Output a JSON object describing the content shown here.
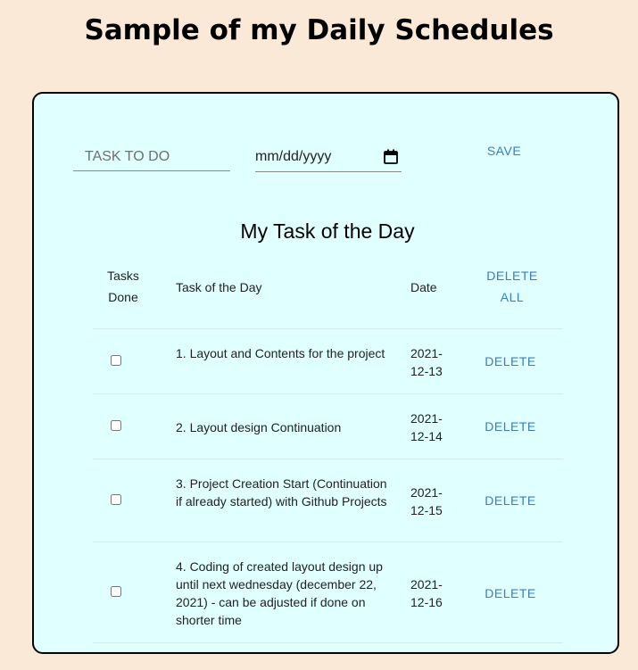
{
  "page": {
    "title": "Sample of my Daily Schedules"
  },
  "form": {
    "task_placeholder": "TASK TO DO",
    "date_placeholder": "mm/dd/yyyy",
    "save_label": "SAVE"
  },
  "list": {
    "title": "My Task of the Day",
    "headers": {
      "done_line1": "Tasks",
      "done_line2": "Done",
      "task": "Task of the Day",
      "date": "Date",
      "delete_all_line1": "DELETE",
      "delete_all_line2": "ALL"
    },
    "rows": [
      {
        "done": false,
        "task": "1. Layout and Contents for the project",
        "date": "2021-12-13",
        "delete_label": "DELETE"
      },
      {
        "done": false,
        "task": "2. Layout design Continuation",
        "date": "2021-12-14",
        "delete_label": "DELETE"
      },
      {
        "done": false,
        "task": "3. Project Creation Start (Continuation if already started) with Github Projects",
        "date": "2021-12-15",
        "delete_label": "DELETE"
      },
      {
        "done": false,
        "task": "4. Coding of created layout design up until next wednesday (december 22, 2021) - can be adjusted if done on shorter time",
        "date": "2021-12-16",
        "delete_label": "DELETE"
      }
    ]
  },
  "colors": {
    "page_background": "#fbe9d7",
    "card_background": "#e0ffff",
    "accent": "#3a7dc1"
  }
}
